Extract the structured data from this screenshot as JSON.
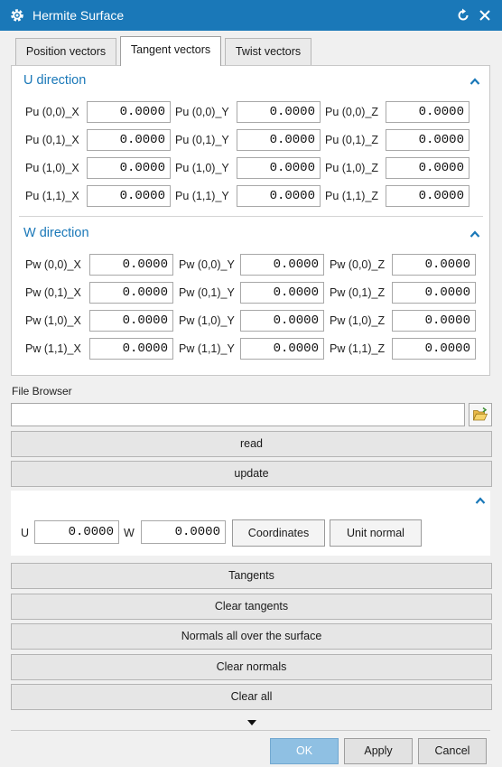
{
  "window": {
    "title": "Hermite Surface",
    "icon": "gear-icon",
    "reset_icon": "reset-icon",
    "close_icon": "close-icon",
    "title_bg": "#1a78b8"
  },
  "tabs": [
    {
      "label": "Position vectors",
      "active": false
    },
    {
      "label": "Tangent vectors",
      "active": true
    },
    {
      "label": "Twist vectors",
      "active": false
    }
  ],
  "u_direction": {
    "title": "U direction",
    "rows": [
      [
        {
          "label": "Pu (0,0)_X",
          "value": "0.0000"
        },
        {
          "label": "Pu (0,0)_Y",
          "value": "0.0000"
        },
        {
          "label": "Pu (0,0)_Z",
          "value": "0.0000"
        }
      ],
      [
        {
          "label": "Pu (0,1)_X",
          "value": "0.0000"
        },
        {
          "label": "Pu (0,1)_Y",
          "value": "0.0000"
        },
        {
          "label": "Pu (0,1)_Z",
          "value": "0.0000"
        }
      ],
      [
        {
          "label": "Pu (1,0)_X",
          "value": "0.0000"
        },
        {
          "label": "Pu (1,0)_Y",
          "value": "0.0000"
        },
        {
          "label": "Pu (1,0)_Z",
          "value": "0.0000"
        }
      ],
      [
        {
          "label": "Pu (1,1)_X",
          "value": "0.0000"
        },
        {
          "label": "Pu (1,1)_Y",
          "value": "0.0000"
        },
        {
          "label": "Pu (1,1)_Z",
          "value": "0.0000"
        }
      ]
    ]
  },
  "w_direction": {
    "title": "W direction",
    "rows": [
      [
        {
          "label": "Pw (0,0)_X",
          "value": "0.0000"
        },
        {
          "label": "Pw (0,0)_Y",
          "value": "0.0000"
        },
        {
          "label": "Pw (0,0)_Z",
          "value": "0.0000"
        }
      ],
      [
        {
          "label": "Pw (0,1)_X",
          "value": "0.0000"
        },
        {
          "label": "Pw (0,1)_Y",
          "value": "0.0000"
        },
        {
          "label": "Pw (0,1)_Z",
          "value": "0.0000"
        }
      ],
      [
        {
          "label": "Pw (1,0)_X",
          "value": "0.0000"
        },
        {
          "label": "Pw (1,0)_Y",
          "value": "0.0000"
        },
        {
          "label": "Pw (1,0)_Z",
          "value": "0.0000"
        }
      ],
      [
        {
          "label": "Pw (1,1)_X",
          "value": "0.0000"
        },
        {
          "label": "Pw (1,1)_Y",
          "value": "0.0000"
        },
        {
          "label": "Pw (1,1)_Z",
          "value": "0.0000"
        }
      ]
    ]
  },
  "file_browser": {
    "label": "File Browser",
    "value": "",
    "folder_icon": "folder-open-icon",
    "read_label": "read",
    "update_label": "update"
  },
  "coordinates": {
    "u_label": "U",
    "u_value": "0.0000",
    "w_label": "W",
    "w_value": "0.0000",
    "coordinates_label": "Coordinates",
    "unit_normal_label": "Unit normal"
  },
  "actions": {
    "tangents": "Tangents",
    "clear_tangents": "Clear tangents",
    "normals_all": "Normals all over the surface",
    "clear_normals": "Clear normals",
    "clear_all": "Clear all",
    "more_icon": "chevron-down-icon"
  },
  "footer": {
    "ok": "OK",
    "apply": "Apply",
    "cancel": "Cancel"
  },
  "colors": {
    "accent": "#1a78b8",
    "ok_button": "#8fc0e3"
  }
}
